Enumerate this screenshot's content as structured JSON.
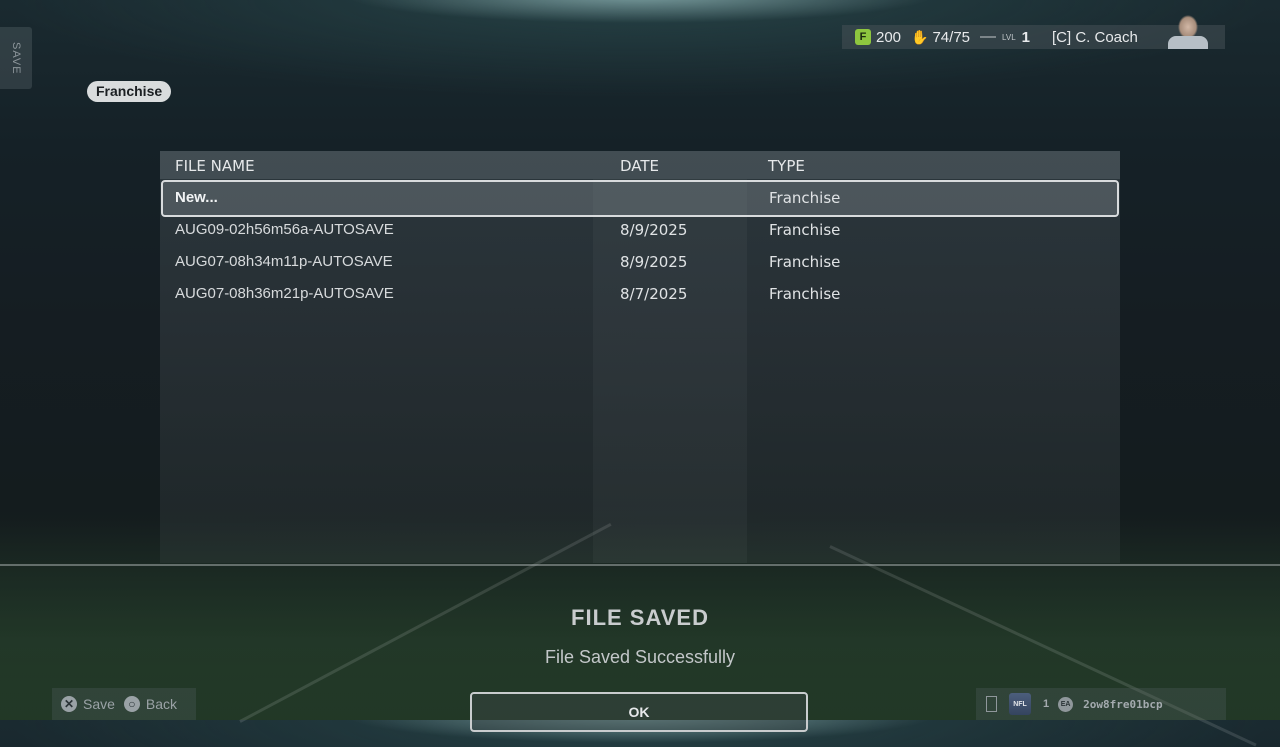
{
  "save_tab": {
    "label": "SAVE"
  },
  "hud": {
    "currency_icon": "F",
    "currency": "200",
    "roster_icon": "gloves-icon",
    "roster": "74/75",
    "level_label": "LVL",
    "level": "1",
    "coach": "[C]  C. Coach"
  },
  "breadcrumb": {
    "label": "Franchise"
  },
  "table": {
    "headers": {
      "name": "FILE NAME",
      "date": "DATE",
      "type": "TYPE"
    },
    "rows": [
      {
        "name": "New...",
        "date": "",
        "type": "Franchise"
      },
      {
        "name": "AUG09-02h56m56a-AUTOSAVE",
        "date": "8/9/2025",
        "type": "Franchise"
      },
      {
        "name": "AUG07-08h34m11p-AUTOSAVE",
        "date": "8/9/2025",
        "type": "Franchise"
      },
      {
        "name": "AUG07-08h36m21p-AUTOSAVE",
        "date": "8/7/2025",
        "type": "Franchise"
      }
    ]
  },
  "dialog": {
    "title": "FILE SAVED",
    "message": "File Saved Successfully",
    "ok_label": "OK"
  },
  "hints": {
    "save_icon": "✕",
    "save_label": "Save",
    "back_icon": "○",
    "back_label": "Back"
  },
  "footer": {
    "logo_text": "NFL",
    "count": "1",
    "ea_text": "EA",
    "gamertag": "2ow8fre01bcp"
  }
}
